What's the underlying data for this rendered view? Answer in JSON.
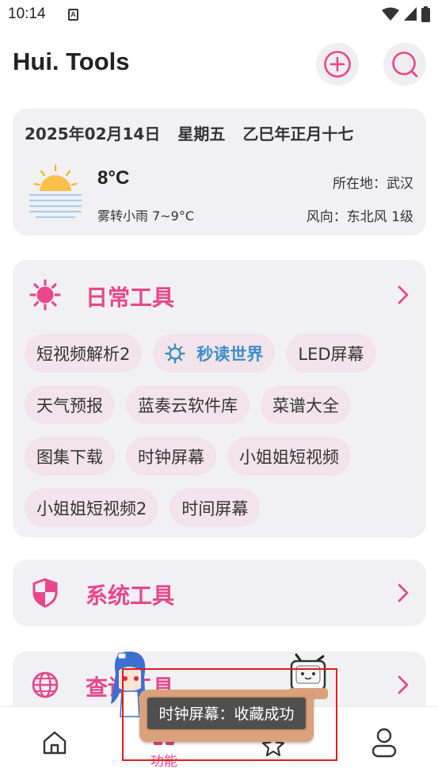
{
  "status_bar": {
    "time": "10:14",
    "notification_glyph": "A",
    "icons": [
      "wifi-icon",
      "signal-icon",
      "battery-icon"
    ]
  },
  "header": {
    "title": "Hui. Tools",
    "buttons": [
      "add-circle-icon",
      "search-icon"
    ]
  },
  "weather": {
    "date": "2025年02月14日",
    "weekday": "星期五",
    "lunar": "乙巳年正月十七",
    "temperature": "8°C",
    "condition": "雾转小雨 7~9°C",
    "location": "所在地：武汉",
    "wind": "风向：东北风 1级",
    "icon": "sun-haze-icon"
  },
  "sections": {
    "daily": {
      "title": "日常工具",
      "icon": "sun-icon",
      "chips": [
        [
          "短视频解析2",
          "秒读世界",
          "LED屏幕"
        ],
        [
          "天气预报",
          "蓝奏云软件库",
          "菜谱大全"
        ],
        [
          "图集下载",
          "时钟屏幕",
          "小姐姐短视频"
        ],
        [
          "小姐姐短视频2",
          "时间屏幕"
        ]
      ]
    },
    "system": {
      "title": "系统工具",
      "icon": "shield-icon"
    },
    "query": {
      "title": "查询工具",
      "icon": "globe-icon"
    }
  },
  "bottom_nav": {
    "items": [
      "home-icon",
      "grid-icon",
      "star-icon",
      "profile-icon"
    ],
    "active_label": "功能"
  },
  "toast": {
    "message": "时钟屏幕：收藏成功"
  },
  "colors": {
    "accent": "#e8478c",
    "card_bg": "#f1f1f3",
    "chip_bg": "#f2e4ea",
    "featured": "#3c8fc8",
    "toast_frame": "#e21b1b"
  }
}
